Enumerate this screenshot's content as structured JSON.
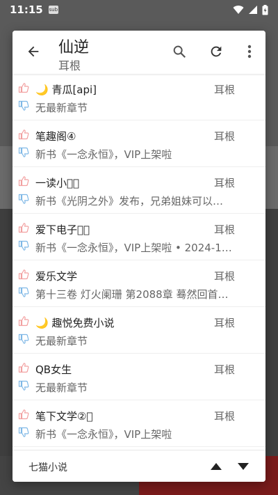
{
  "status_bar": {
    "time": "11:15",
    "notification_badge": "sub"
  },
  "dialog": {
    "title": "仙逆",
    "subtitle": "耳根",
    "icons": {
      "back": "arrow-back-icon",
      "search": "search-icon",
      "refresh": "refresh-icon",
      "more": "more-vert-icon"
    }
  },
  "sources": [
    {
      "name": "🌙 青瓜[api]",
      "author": "耳根",
      "latest": "无最新章节"
    },
    {
      "name": "笔趣阁④",
      "author": "耳根",
      "latest": "新书《一念永恒》，VIP上架啦"
    },
    {
      "name": "一读小说⃠",
      "author": "耳根",
      "latest": "新书《光阴之外》发布，兄弟姐妹可以…"
    },
    {
      "name": "爱下电子书⃠",
      "author": "耳根",
      "latest": "新书《一念永恒》，VIP上架啦 • 2024-1…"
    },
    {
      "name": "爱乐文学",
      "author": "耳根",
      "latest": "第十三卷 灯火阑珊 第2088章 蓦然回首…"
    },
    {
      "name": "🌙 趣悦免费小说",
      "author": "耳根",
      "latest": "无最新章节"
    },
    {
      "name": "QB女生",
      "author": "耳根",
      "latest": "无最新章节"
    },
    {
      "name": "笔下文学②⃠",
      "author": "耳根",
      "latest": "新书《一念永恒》，VIP上架啦"
    }
  ],
  "footer": {
    "group_label": "七猫小说"
  },
  "colors": {
    "thumb_up": "#f2a0a0",
    "thumb_down": "#7fb8e6",
    "icon": "#555555"
  }
}
